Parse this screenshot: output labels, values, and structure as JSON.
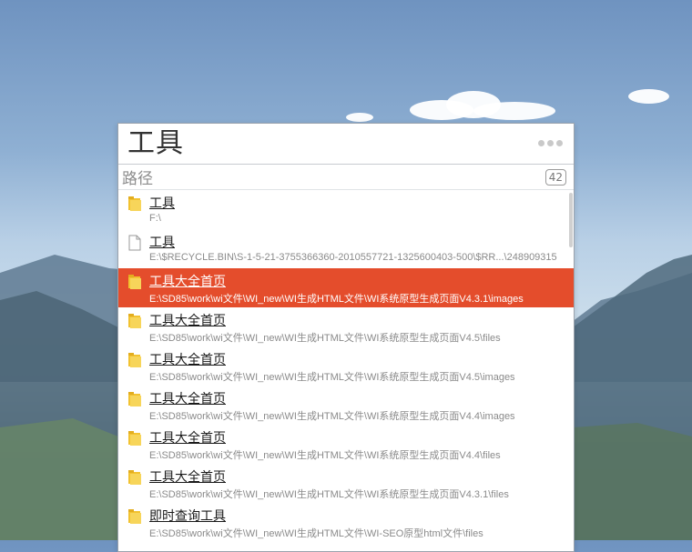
{
  "search": {
    "query": "工具"
  },
  "group": {
    "title": "路径",
    "count": "42"
  },
  "results": [
    {
      "title": "工具",
      "path": "F:\\",
      "icon": "folder-icon"
    },
    {
      "title": "工具",
      "path": "E:\\$RECYCLE.BIN\\S-1-5-21-3755366360-2010557721-1325600403-500\\$RR...\\248909315",
      "icon": "file-icon"
    },
    {
      "title": "工具大全首页",
      "path": "E:\\SD85\\work\\wi文件\\WI_new\\WI生成HTML文件\\WI系统原型生成页面V4.3.1\\images",
      "icon": "folder-icon",
      "selected": true
    },
    {
      "title": "工具大全首页",
      "path": "E:\\SD85\\work\\wi文件\\WI_new\\WI生成HTML文件\\WI系统原型生成页面V4.5\\files",
      "icon": "folder-icon"
    },
    {
      "title": "工具大全首页",
      "path": "E:\\SD85\\work\\wi文件\\WI_new\\WI生成HTML文件\\WI系统原型生成页面V4.5\\images",
      "icon": "folder-icon"
    },
    {
      "title": "工具大全首页",
      "path": "E:\\SD85\\work\\wi文件\\WI_new\\WI生成HTML文件\\WI系统原型生成页面V4.4\\images",
      "icon": "folder-icon"
    },
    {
      "title": "工具大全首页",
      "path": "E:\\SD85\\work\\wi文件\\WI_new\\WI生成HTML文件\\WI系统原型生成页面V4.4\\files",
      "icon": "folder-icon"
    },
    {
      "title": "工具大全首页",
      "path": "E:\\SD85\\work\\wi文件\\WI_new\\WI生成HTML文件\\WI系统原型生成页面V4.3.1\\files",
      "icon": "folder-icon"
    },
    {
      "title": "即时查询工具",
      "path": "E:\\SD85\\work\\wi文件\\WI_new\\WI生成HTML文件\\WI-SEO原型html文件\\files",
      "icon": "folder-icon"
    }
  ],
  "colors": {
    "selection": "#e44d2c",
    "folder": "#f2c230"
  }
}
